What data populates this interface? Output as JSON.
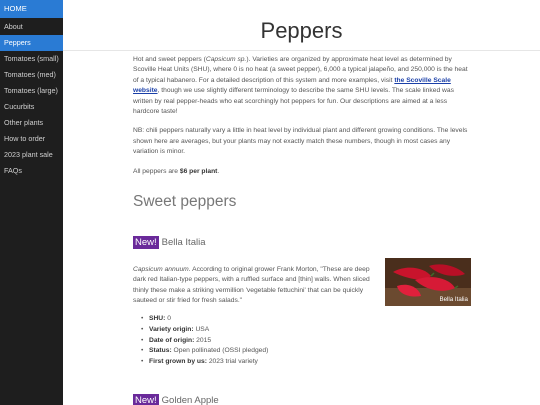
{
  "sidebar": {
    "home": "HOME",
    "items": [
      {
        "label": "About"
      },
      {
        "label": "Peppers"
      },
      {
        "label": "Tomatoes (small)"
      },
      {
        "label": "Tomatoes (med)"
      },
      {
        "label": "Tomatoes (large)"
      },
      {
        "label": "Cucurbits"
      },
      {
        "label": "Other plants"
      },
      {
        "label": "How to order"
      },
      {
        "label": "2023 plant sale"
      },
      {
        "label": "FAQs"
      }
    ],
    "active": "Peppers"
  },
  "page": {
    "title": "Peppers",
    "intro": {
      "p1_a": "Hot and sweet peppers (",
      "p1_species": "Capsicum sp.",
      "p1_b": "). Varieties are organized by approximate heat level as determined by Scoville Heat Units (SHU), where 0 is no heat (a sweet pepper), 6,000 a typical jalapeño, and 250,000 is the heat of a typical habanero. For a detailed description of this system and more examples, visit ",
      "link_text": "the Scoville Scale website",
      "p1_c": ", though we use slightly different terminology to describe the same SHU levels. The scale linked was written by real pepper-heads who eat scorchingly hot peppers for fun. Our descriptions are aimed at a less hardcore taste!",
      "p2": "NB: chili peppers naturally vary a little in heat level by individual plant and different growing conditions. The levels shown here are averages, but your plants may not exactly match these numbers, though in most cases any variation is minor.",
      "p3_a": "All peppers are ",
      "p3_price": "$6 per plant",
      "p3_b": "."
    },
    "section_title": "Sweet peppers",
    "products": [
      {
        "badge": "New!",
        "name": "Bella Italia",
        "species": "Capsicum annuum",
        "description": ". According to original grower Frank Morton, \"These are deep dark red Italian-type peppers, with a ruffled surface and [thin] walls. When sliced thinly these make a striking vermillion 'vegetable fettuchini' that can be quickly sauteed or stir fried for fresh salads.\"",
        "photo_caption": "Bella Italia",
        "specs": [
          {
            "label": "SHU:",
            "value": " 0"
          },
          {
            "label": "Variety origin:",
            "value": " USA"
          },
          {
            "label": "Date of origin:",
            "value": " 2015"
          },
          {
            "label": "Status:",
            "value": " Open pollinated (OSSI pledged)"
          },
          {
            "label": "First grown by us:",
            "value": " 2023 trial variety"
          }
        ]
      },
      {
        "badge": "New!",
        "name": "Golden Apple"
      }
    ]
  },
  "colors": {
    "sidebar_bg": "#1e1e1e",
    "active_nav": "#2a7bd4",
    "badge": "#6a2a9a",
    "link": "#1a3fa8"
  }
}
